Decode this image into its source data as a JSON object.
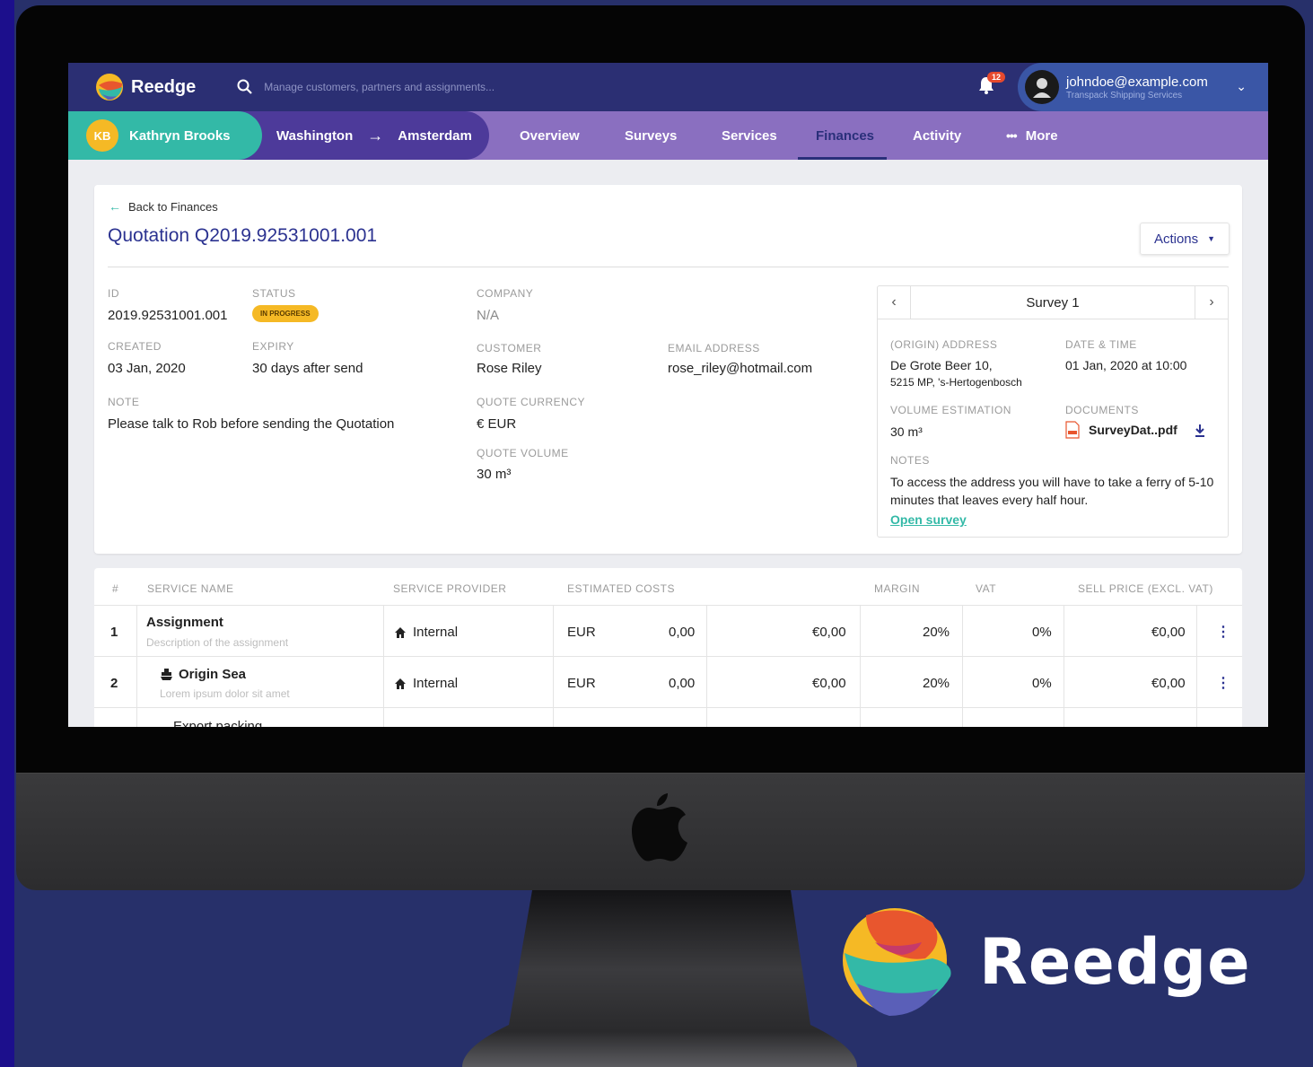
{
  "app": {
    "name": "Reedge"
  },
  "search": {
    "placeholder": "Manage customers, partners and assignments..."
  },
  "notifications": {
    "count": "12"
  },
  "user": {
    "email": "johndoe@example.com",
    "company": "Transpack Shipping Services"
  },
  "customer": {
    "initials": "KB",
    "name": "Kathryn Brooks"
  },
  "route": {
    "from": "Washington",
    "arrow": "→",
    "to": "Amsterdam"
  },
  "tabs": [
    {
      "label": "Overview"
    },
    {
      "label": "Surveys"
    },
    {
      "label": "Services"
    },
    {
      "label": "Finances",
      "active": true
    },
    {
      "label": "Activity"
    },
    {
      "label": "More"
    }
  ],
  "quotation": {
    "back_label": "Back to Finances",
    "title": "Quotation Q2019.92531001.001",
    "actions_label": "Actions",
    "id_label": "ID",
    "id": "2019.92531001.001",
    "status_label": "STATUS",
    "status": "IN PROGRESS",
    "created_label": "CREATED",
    "created": "03 Jan, 2020",
    "expiry_label": "EXPIRY",
    "expiry": "30 days after send",
    "note_label": "NOTE",
    "note": "Please talk to Rob before sending the Quotation",
    "company_label": "COMPANY",
    "company": "N/A",
    "customer_label": "CUSTOMER",
    "customer": "Rose Riley",
    "email_label": "EMAIL ADDRESS",
    "email": "rose_riley@hotmail.com",
    "currency_label": "QUOTE CURRENCY",
    "currency": "€ EUR",
    "volume_label": "QUOTE VOLUME",
    "volume": "30 m³"
  },
  "survey": {
    "title": "Survey 1",
    "address_label": "(ORIGIN) ADDRESS",
    "address_line1": "De Grote Beer 10,",
    "address_line2": "5215 MP, 's-Hertogenbosch",
    "datetime_label": "DATE & TIME",
    "datetime": "01 Jan, 2020 at 10:00",
    "volume_label": "VOLUME ESTIMATION",
    "volume": "30 m³",
    "documents_label": "DOCUMENTS",
    "document": "SurveyDat..pdf",
    "notes_label": "NOTES",
    "notes": "To access the address you will have to take a ferry of 5-10 minutes that leaves every half hour.",
    "open_label": "Open survey"
  },
  "services_table": {
    "headers": [
      "#",
      "SERVICE NAME",
      "SERVICE PROVIDER",
      "ESTIMATED COSTS",
      "MARGIN",
      "VAT",
      "SELL PRICE (EXCL. VAT)"
    ],
    "rows": [
      {
        "num": "1",
        "name": "Assignment",
        "desc": "Description of the assignment",
        "provider": "Internal",
        "currency": "EUR",
        "cost": "0,00",
        "estimated": "€0,00",
        "margin": "20%",
        "vat": "0%",
        "sell": "€0,00"
      },
      {
        "num": "2",
        "name": "Origin Sea",
        "desc": "Lorem ipsum dolor sit amet",
        "provider": "Internal",
        "currency": "EUR",
        "cost": "0,00",
        "estimated": "€0,00",
        "margin": "20%",
        "vat": "0%",
        "sell": "€0,00"
      },
      {
        "num": "",
        "name": "Export packing",
        "desc": "",
        "provider": "",
        "currency": "",
        "cost": "",
        "estimated": "",
        "margin": "",
        "vat": "",
        "sell": ""
      }
    ]
  },
  "colors": {
    "brand_navy": "#2b2f73",
    "nav_purple": "#8a6fc0",
    "teal": "#33b9a7",
    "status_yellow": "#f5b925",
    "link_blue": "#2b3290"
  }
}
